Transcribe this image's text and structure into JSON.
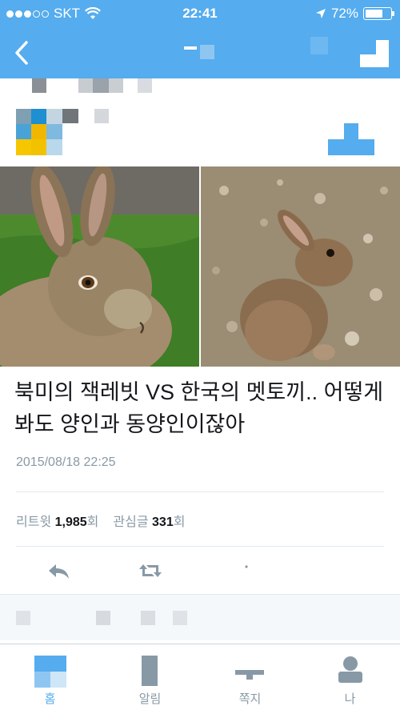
{
  "status_bar": {
    "carrier": "SKT",
    "time": "22:41",
    "battery": "72%",
    "battery_level": 0.72
  },
  "nav": {
    "back_icon": "chevron-left-icon",
    "compose_icon": "compose-icon"
  },
  "tweet": {
    "image_left": "jackrabbit-photo",
    "image_right": "korean-hare-photo",
    "text": "북미의 잭레빗 VS 한국의 멧토끼.. 어떻게 봐도 양인과 동양인이잖아",
    "timestamp": "2015/08/18 22:25",
    "stats": {
      "retweet_label": "리트윗",
      "retweet_count": "1,985",
      "retweet_unit": "회",
      "like_label": "관심글",
      "like_count": "331",
      "like_unit": "회"
    }
  },
  "colors": {
    "accent": "#55acee",
    "text_primary": "#14171a",
    "text_secondary": "#8899a6"
  },
  "tabs": [
    {
      "label": "홈",
      "icon": "home-icon",
      "active": true
    },
    {
      "label": "알림",
      "icon": "notifications-icon",
      "active": false
    },
    {
      "label": "쪽지",
      "icon": "messages-icon",
      "active": false
    },
    {
      "label": "나",
      "icon": "profile-icon",
      "active": false
    }
  ]
}
